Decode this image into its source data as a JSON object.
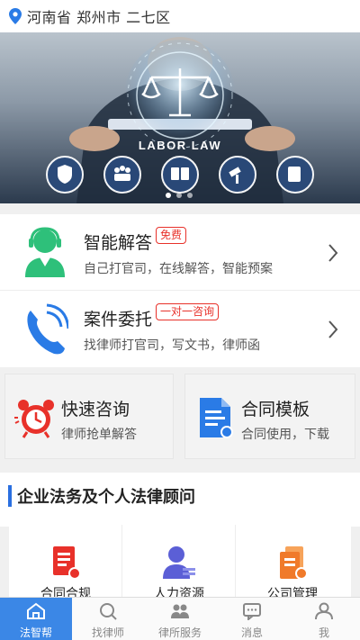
{
  "location": {
    "text": "河南省 郑州市 二七区"
  },
  "banner": {
    "text": "LABOR LAW",
    "slides": 3,
    "active_slide": 1
  },
  "services": [
    {
      "title": "智能解答",
      "badge": "免费",
      "subtitle": "自己打官司，在线解答，智能预案"
    },
    {
      "title": "案件委托",
      "badge": "一对一咨询",
      "subtitle": "找律师打官司，写文书，律师函"
    }
  ],
  "tiles": [
    {
      "title": "快速咨询",
      "subtitle": "律师抢单解答"
    },
    {
      "title": "合同模板",
      "subtitle": "合同使用，下载"
    }
  ],
  "section": {
    "title": "企业法务及个人法律顾问"
  },
  "grid": [
    {
      "label": "合同合规"
    },
    {
      "label": "人力资源"
    },
    {
      "label": "公司管理"
    }
  ],
  "tabbar": {
    "active": 0,
    "tabs": [
      {
        "label": "法智帮",
        "icon": "home-icon"
      },
      {
        "label": "找律师",
        "icon": "search-icon"
      },
      {
        "label": "律所服务",
        "icon": "people-icon"
      },
      {
        "label": "消息",
        "icon": "message-icon"
      },
      {
        "label": "我",
        "icon": "person-icon"
      }
    ]
  },
  "colors": {
    "accent": "#3b87e6",
    "badge_red": "#e8312a",
    "icon_green": "#2ec07a",
    "icon_blue": "#2a7be6",
    "icon_red": "#e8312a",
    "icon_orange": "#f07a2a"
  }
}
